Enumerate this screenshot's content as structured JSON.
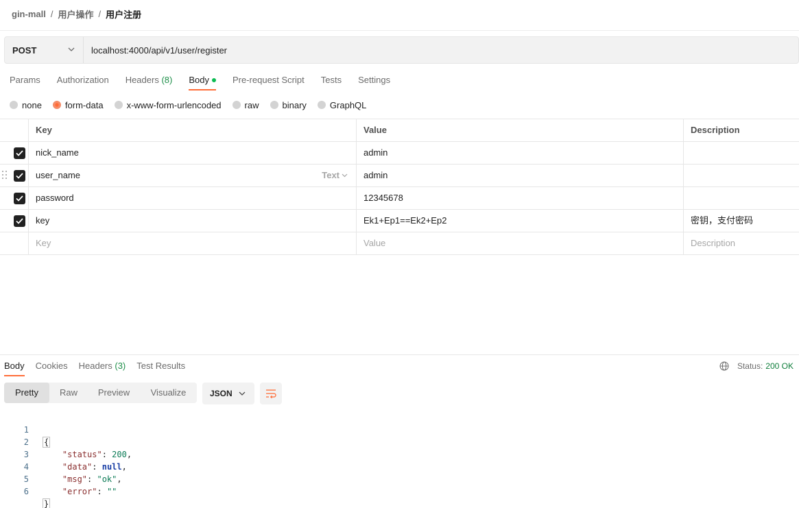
{
  "breadcrumb": {
    "items": [
      "gin-mall",
      "用户操作"
    ],
    "separator": "/",
    "current": "用户注册"
  },
  "request": {
    "method": "POST",
    "url": "localhost:4000/api/v1/user/register"
  },
  "request_tabs": [
    {
      "label": "Params"
    },
    {
      "label": "Authorization"
    },
    {
      "label": "Headers",
      "count": "(8)"
    },
    {
      "label": "Body",
      "active": true
    },
    {
      "label": "Pre-request Script"
    },
    {
      "label": "Tests"
    },
    {
      "label": "Settings"
    }
  ],
  "body_types": [
    {
      "label": "none"
    },
    {
      "label": "form-data",
      "selected": true
    },
    {
      "label": "x-www-form-urlencoded"
    },
    {
      "label": "raw"
    },
    {
      "label": "binary"
    },
    {
      "label": "GraphQL"
    }
  ],
  "table": {
    "headers": {
      "key": "Key",
      "value": "Value",
      "description": "Description"
    },
    "rows": [
      {
        "key": "nick_name",
        "value": "admin",
        "description": "",
        "checked": true
      },
      {
        "key": "user_name",
        "value": "admin",
        "description": "",
        "checked": true,
        "type_label": "Text"
      },
      {
        "key": "password",
        "value": "12345678",
        "description": "",
        "checked": true
      },
      {
        "key": "key",
        "value": "Ek1+Ep1==Ek2+Ep2",
        "description": "密钥，支付密码",
        "checked": true
      }
    ],
    "placeholder": {
      "key": "Key",
      "value": "Value",
      "description": "Description"
    }
  },
  "response_tabs": [
    {
      "label": "Body",
      "active": true
    },
    {
      "label": "Cookies"
    },
    {
      "label": "Headers",
      "count": "(3)"
    },
    {
      "label": "Test Results"
    }
  ],
  "status": {
    "label": "Status:",
    "code": "200 OK"
  },
  "view_modes": [
    {
      "label": "Pretty",
      "selected": true
    },
    {
      "label": "Raw"
    },
    {
      "label": "Preview"
    },
    {
      "label": "Visualize"
    }
  ],
  "format": "JSON",
  "code": {
    "line_numbers": [
      "1",
      "2",
      "3",
      "4",
      "5",
      "6"
    ],
    "open_brace": "{",
    "close_brace": "}",
    "entries": [
      {
        "key": "\"status\"",
        "value": "200",
        "kind": "num",
        "trail": ","
      },
      {
        "key": "\"data\"",
        "value": "null",
        "kind": "kw",
        "trail": ","
      },
      {
        "key": "\"msg\"",
        "value": "\"ok\"",
        "kind": "str",
        "trail": ","
      },
      {
        "key": "\"error\"",
        "value": "\"\"",
        "kind": "str",
        "trail": ""
      }
    ]
  },
  "colors": {
    "accent": "#ff6c37",
    "status_green": "#0f7e3b",
    "dot_green": "#0cbb52"
  }
}
